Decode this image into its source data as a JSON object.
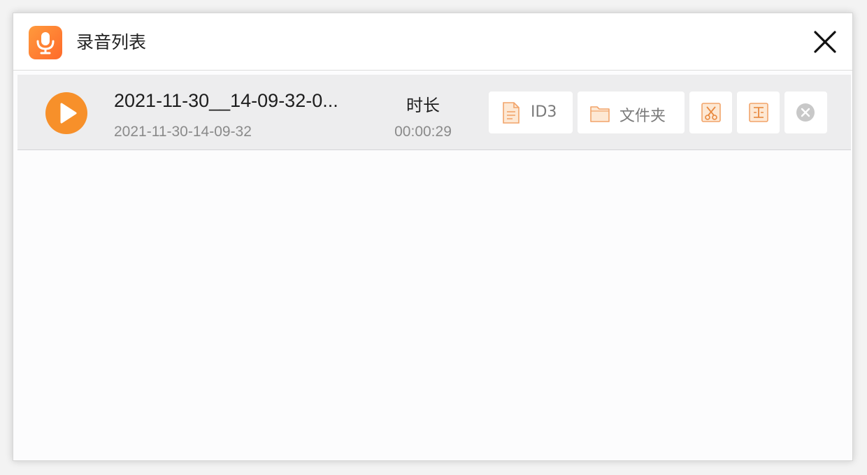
{
  "window": {
    "title": "录音列表"
  },
  "icons": {
    "app": "microphone-icon",
    "close": "close-icon",
    "play": "play-icon",
    "id3": "document-icon",
    "folder": "folder-icon",
    "cut": "scissors-icon",
    "edit": "edit-text-icon",
    "delete": "remove-icon"
  },
  "colors": {
    "accent": "#f7902a",
    "brand_gradient_start": "#ff9a3d",
    "brand_gradient_end": "#ff6a2a",
    "row_background": "#ededee"
  },
  "recordings": [
    {
      "name": "2021-11-30__14-09-32-0...",
      "date": "2021-11-30-14-09-32",
      "duration_label": "时长",
      "duration": "00:00:29",
      "actions": {
        "id3_label": "ID3",
        "folder_label": "文件夹"
      }
    }
  ]
}
